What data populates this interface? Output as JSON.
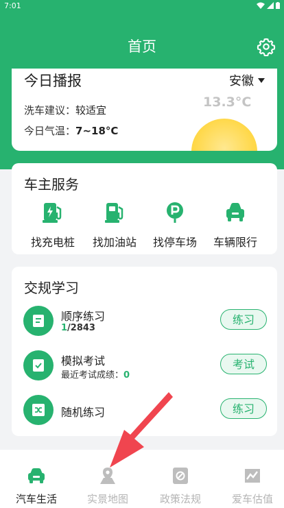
{
  "status": {
    "time": "7:01"
  },
  "header": {
    "title": "首页"
  },
  "weather": {
    "title": "今日播报",
    "province": "安徽",
    "wash_label": "洗车建议：",
    "wash_value": "较适宜",
    "temp_label": "今日气温：",
    "temp_range": "7~18°C",
    "current_temp": "13.3°C"
  },
  "services": {
    "title": "车主服务",
    "items": [
      {
        "label": "找充电桩",
        "icon": "charging-pile-icon"
      },
      {
        "label": "找加油站",
        "icon": "gas-station-icon"
      },
      {
        "label": "找停车场",
        "icon": "parking-icon"
      },
      {
        "label": "车辆限行",
        "icon": "car-restriction-icon"
      }
    ]
  },
  "study": {
    "title": "交规学习",
    "items": [
      {
        "name": "顺序练习",
        "progress_current": "1",
        "progress_total": "/2843",
        "button": "练习"
      },
      {
        "name": "模拟考试",
        "score_label": "最近考试成绩：",
        "score": "0",
        "button": "考试"
      },
      {
        "name": "随机练习",
        "button": "练习"
      }
    ]
  },
  "nav": {
    "tabs": [
      {
        "label": "汽车生活",
        "active": true
      },
      {
        "label": "实景地图",
        "active": false
      },
      {
        "label": "政策法规",
        "active": false
      },
      {
        "label": "爱车估值",
        "active": false
      }
    ]
  },
  "colors": {
    "primary": "#27b26f",
    "pill_bg": "#e9f8f0",
    "sun": "#ffd84a",
    "inactive": "#b5b5b5",
    "arrow": "#f0454f"
  }
}
